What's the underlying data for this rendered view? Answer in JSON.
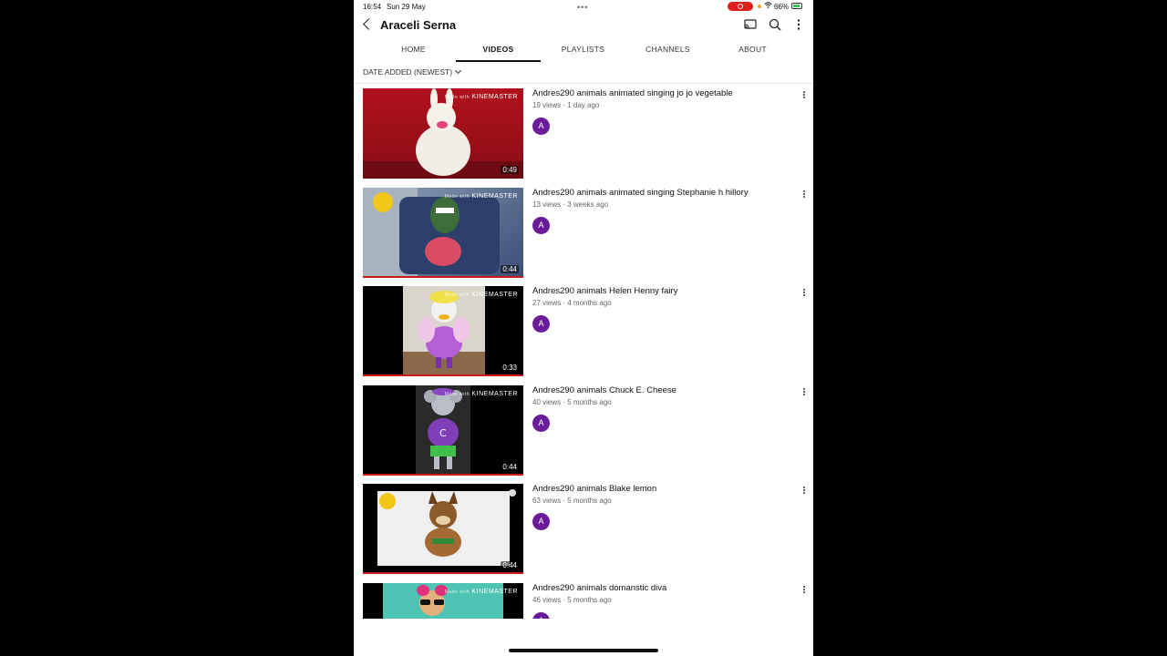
{
  "status_bar": {
    "time": "16:54",
    "date": "Sun 29 May",
    "battery": "66%"
  },
  "header": {
    "channel_name": "Araceli Serna"
  },
  "tabs": [
    {
      "label": "HOME"
    },
    {
      "label": "VIDEOS",
      "active": true
    },
    {
      "label": "PLAYLISTS"
    },
    {
      "label": "CHANNELS"
    },
    {
      "label": "ABOUT"
    }
  ],
  "sort": {
    "label": "DATE ADDED (NEWEST)"
  },
  "videos": [
    {
      "title": "Andres290 animals animated singing jo jo vegetable",
      "meta": "19 views · 1 day ago",
      "duration": "0:49",
      "avatar": "A",
      "watermark": "KINEMASTER",
      "watermark_prefix": "Made with"
    },
    {
      "title": "Andres290 animals animated singing Stephanie h hillory",
      "meta": "13 views · 3 weeks ago",
      "duration": "0:44",
      "avatar": "A",
      "watermark": "KINEMASTER",
      "watermark_prefix": "Made with"
    },
    {
      "title": "Andres290 animals Helen Henny fairy",
      "meta": "27 views · 4 months ago",
      "duration": "0:33",
      "avatar": "A",
      "watermark": "KINEMASTER",
      "watermark_prefix": "Made with"
    },
    {
      "title": "Andres290 animals Chuck E. Cheese",
      "meta": "40 views · 5 months ago",
      "duration": "0:44",
      "avatar": "A",
      "watermark": "KINEMASTER",
      "watermark_prefix": "Made with"
    },
    {
      "title": "Andres290 animals Blake lemon",
      "meta": "63 views · 5 months ago",
      "duration": "0:44",
      "avatar": "A"
    },
    {
      "title": "Andres290 animals domanstic diva",
      "meta": "46 views · 5 months ago",
      "duration": "",
      "avatar": "A",
      "watermark": "KINEMASTER",
      "watermark_prefix": "Made with"
    }
  ],
  "colors": {
    "accent_red": "#cc1a1a",
    "avatar_purple": "#6a1b9a",
    "record_red": "#e01d1d"
  }
}
